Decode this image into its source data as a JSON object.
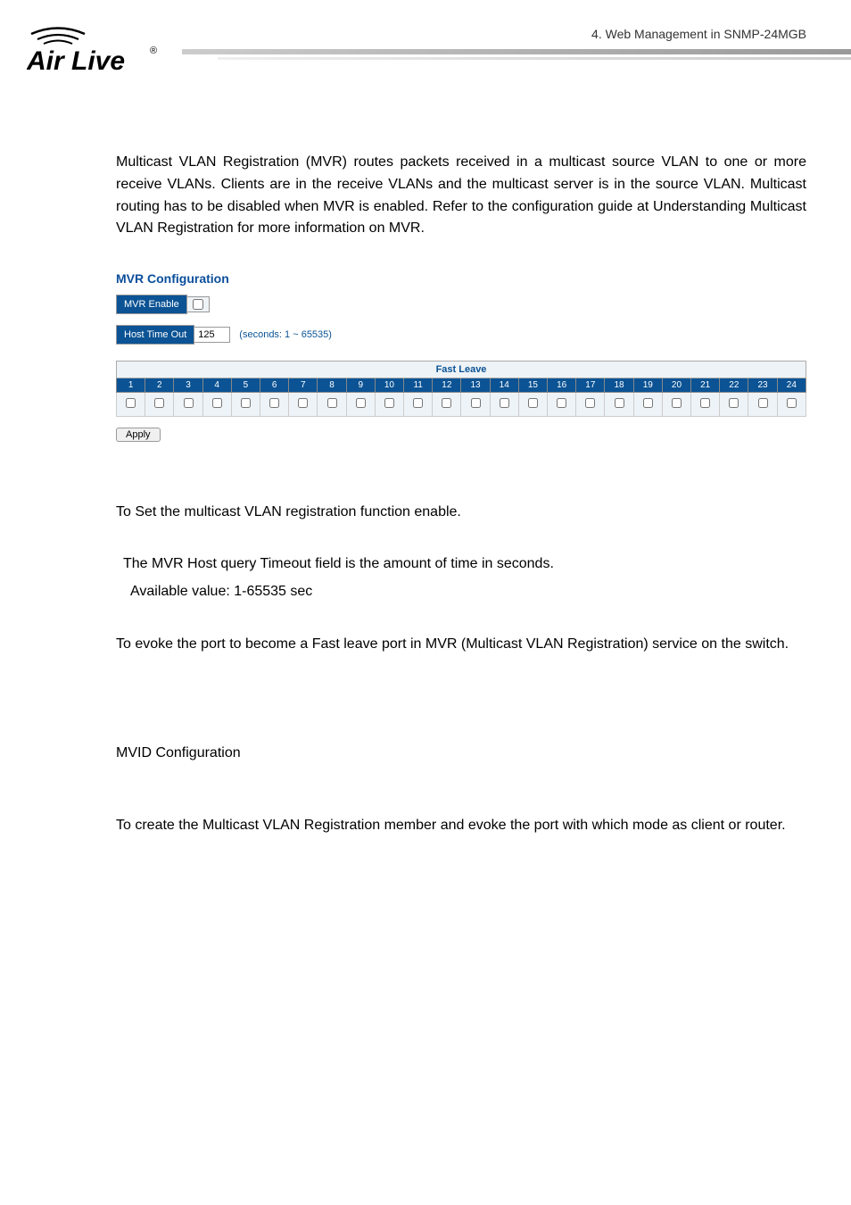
{
  "header": {
    "chapter": "4.  Web  Management  in  SNMP-24MGB",
    "logo_brand": "Air Live"
  },
  "intro_para": "Multicast VLAN Registration (MVR) routes packets received in a multicast source VLAN to one or more receive VLANs. Clients are in the receive VLANs and the multicast server is in the source VLAN. Multicast routing has to be disabled when MVR is enabled. Refer to the configuration guide at Understanding Multicast VLAN Registration for more information on MVR.",
  "screenshot": {
    "title": "MVR Configuration",
    "mvr_enable_label": "MVR Enable",
    "host_timeout_label": "Host Time Out",
    "host_timeout_value": "125",
    "host_timeout_hint": "(seconds: 1 ~ 65535)",
    "fast_leave_header": "Fast Leave",
    "ports": [
      "1",
      "2",
      "3",
      "4",
      "5",
      "6",
      "7",
      "8",
      "9",
      "10",
      "11",
      "12",
      "13",
      "14",
      "15",
      "16",
      "17",
      "18",
      "19",
      "20",
      "21",
      "22",
      "23",
      "24"
    ],
    "apply_label": "Apply"
  },
  "desc": {
    "line1": "To Set the multicast VLAN registration function enable.",
    "line2": "The MVR Host query Timeout field is the amount of time in seconds.",
    "line3": "Available value: 1-65535 sec",
    "line4": "To evoke the port to become a Fast leave port in MVR (Multicast VLAN Registration) service on the switch."
  },
  "mvid": {
    "heading": "MVID Configuration",
    "para": "To create the Multicast VLAN Registration member and evoke the port with which mode as client or router."
  }
}
